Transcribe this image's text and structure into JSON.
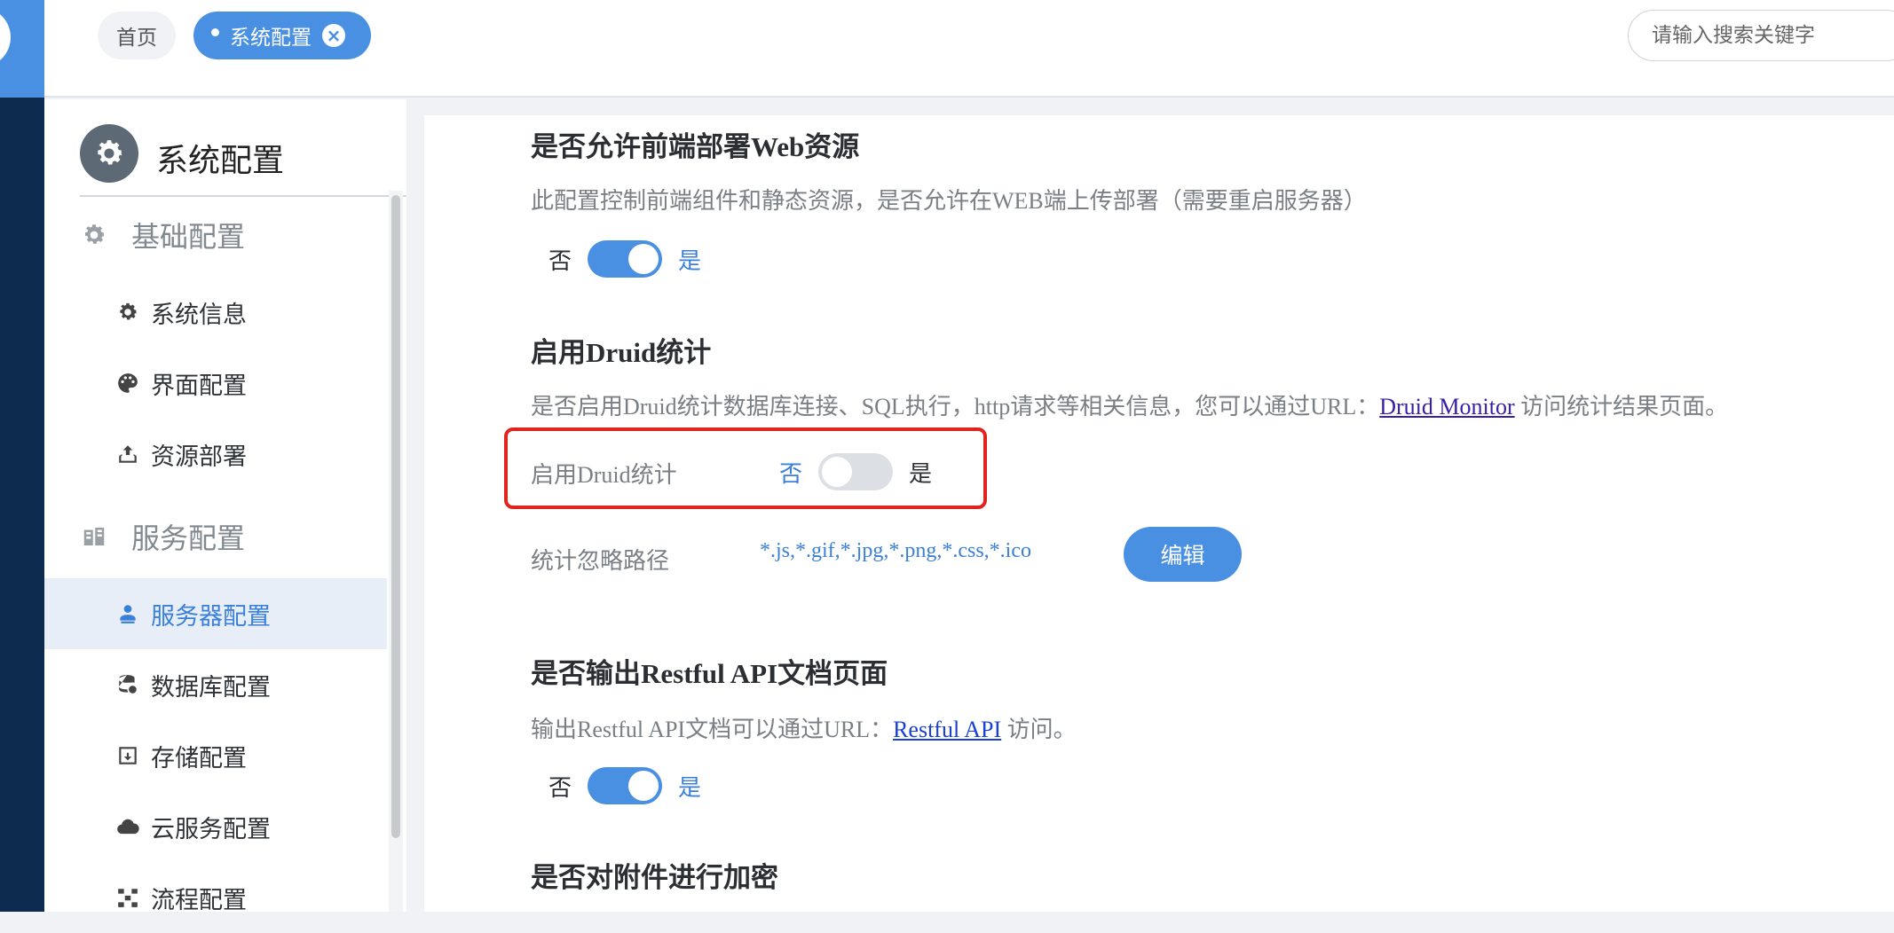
{
  "tabs": [
    {
      "label": "首页"
    },
    {
      "label": "系统配置"
    }
  ],
  "search": {
    "placeholder": "请输入搜索关键字"
  },
  "sidebar": {
    "title": "系统配置",
    "groups": [
      {
        "label": "基础配置",
        "items": [
          {
            "label": "系统信息",
            "icon": "gear-icon"
          },
          {
            "label": "界面配置",
            "icon": "palette-icon"
          },
          {
            "label": "资源部署",
            "icon": "upload-icon"
          }
        ]
      },
      {
        "label": "服务配置",
        "items": [
          {
            "label": "服务器配置",
            "icon": "server-user-icon",
            "active": true
          },
          {
            "label": "数据库配置",
            "icon": "database-icon"
          },
          {
            "label": "存储配置",
            "icon": "archive-icon"
          },
          {
            "label": "云服务配置",
            "icon": "cloud-icon"
          },
          {
            "label": "流程配置",
            "icon": "flow-icon"
          }
        ]
      }
    ]
  },
  "main": {
    "web_deploy": {
      "title": "是否允许前端部署Web资源",
      "desc": "此配置控制前端组件和静态资源，是否允许在WEB端上传部署（需要重启服务器）",
      "off_label": "否",
      "on_label": "是",
      "enabled": true
    },
    "druid": {
      "title": "启用Druid统计",
      "desc_prefix": "是否启用Druid统计数据库连接、SQL执行，http请求等相关信息，您可以通过URL：",
      "desc_link": "Druid Monitor",
      "desc_suffix": " 访问统计结果页面。",
      "field_label": "启用Druid统计",
      "off_label": "否",
      "on_label": "是",
      "enabled": false,
      "ignore_label": "统计忽略路径",
      "ignore_value": "*.js,*.gif,*.jpg,*.png,*.css,*.ico",
      "edit_label": "编辑"
    },
    "restful": {
      "title": "是否输出Restful API文档页面",
      "desc_prefix": "输出Restful API文档可以通过URL：",
      "desc_link": "Restful API",
      "desc_suffix": " 访问。",
      "off_label": "否",
      "on_label": "是",
      "enabled": true
    },
    "encrypt": {
      "title": "是否对附件进行加密"
    }
  },
  "colors": {
    "accent": "#4a90e2",
    "sidebar_dark": "#0d2a4f",
    "highlight": "#e3231e"
  }
}
